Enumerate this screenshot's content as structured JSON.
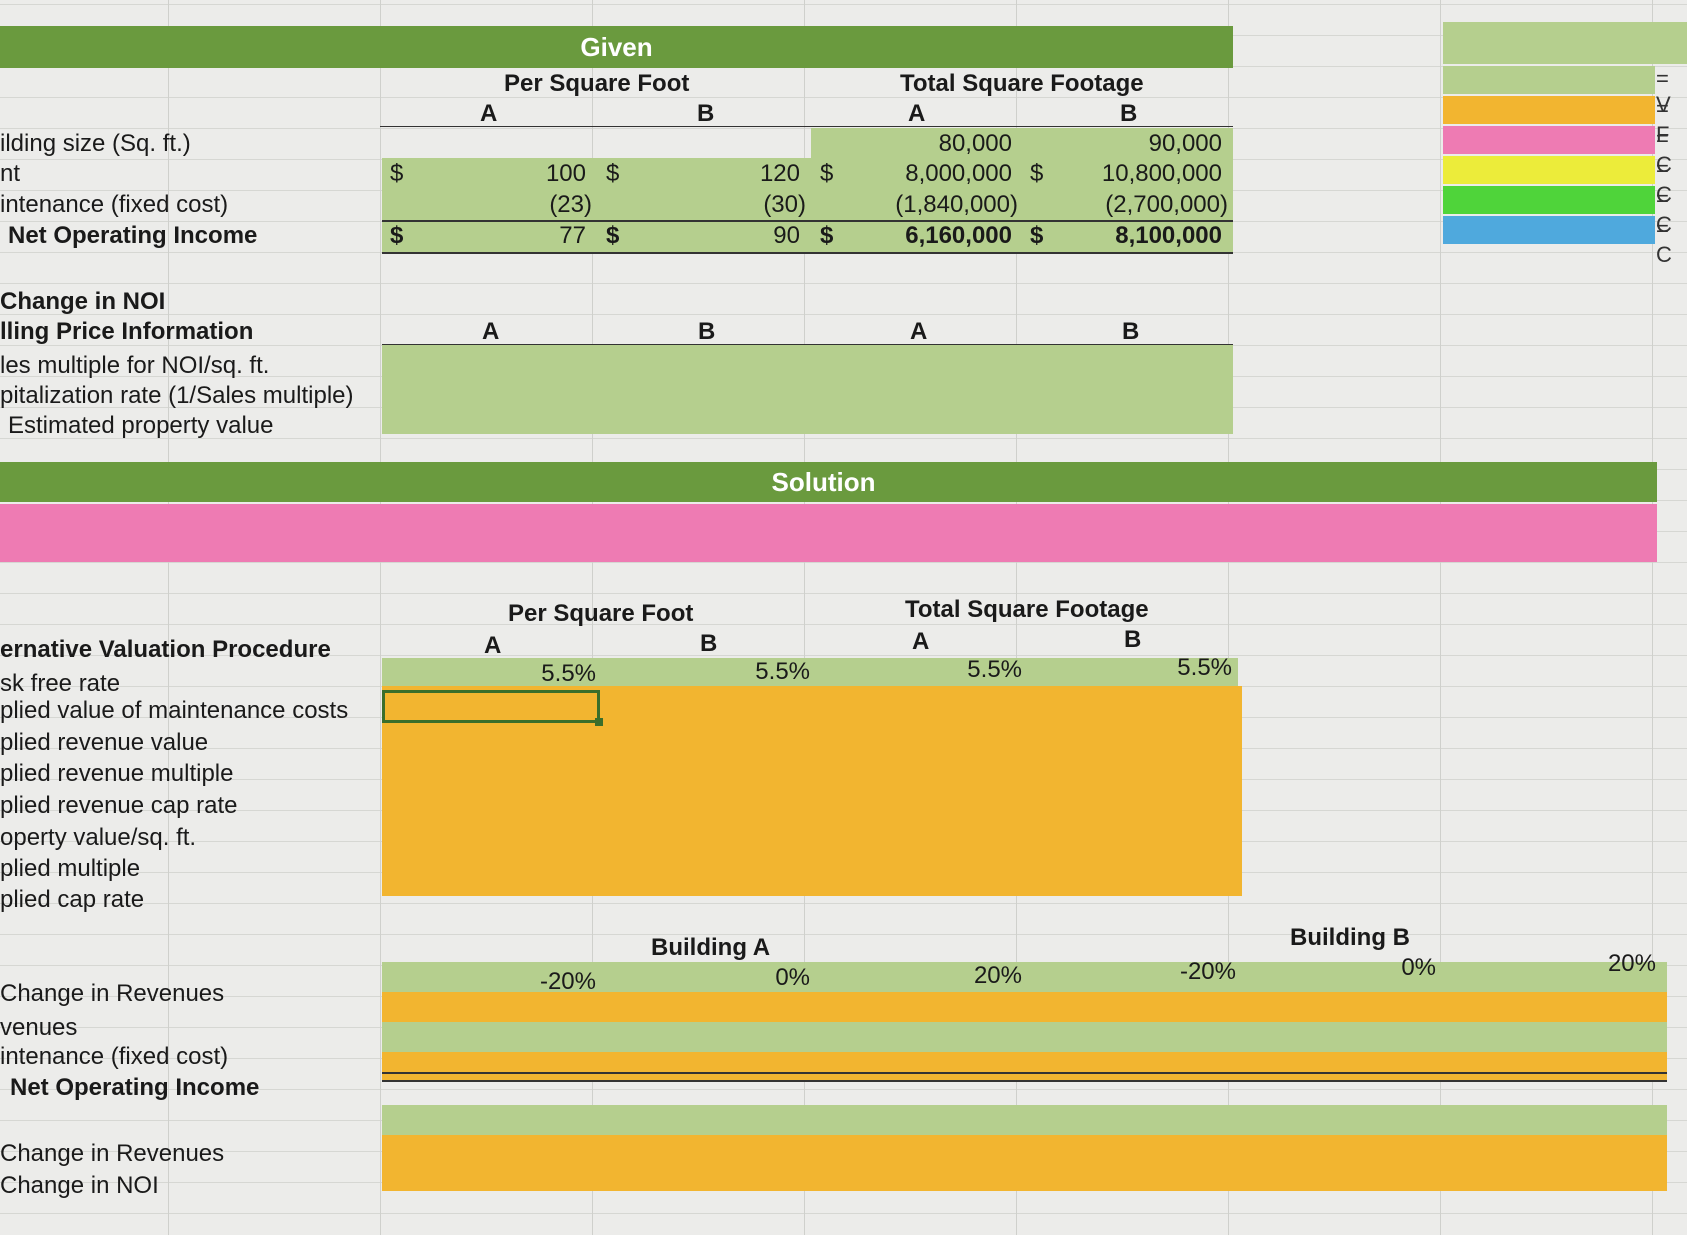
{
  "given": {
    "title": "Given",
    "per_sq_ft": "Per Square Foot",
    "total_sq_ft": "Total Square Footage",
    "col_a": "A",
    "col_b": "B",
    "rows": {
      "building_size": "ilding size (Sq. ft.)",
      "rent": "nt",
      "maintenance": "intenance (fixed cost)",
      "noi": "Net Operating Income"
    },
    "values": {
      "size_a_total": "80,000",
      "size_b_total": "90,000",
      "rent_a_psf": "100",
      "rent_b_psf": "120",
      "rent_a_total": "8,000,000",
      "rent_b_total": "10,800,000",
      "maint_a_psf": "(23)",
      "maint_b_psf": "(30)",
      "maint_a_total": "(1,840,000)",
      "maint_b_total": "(2,700,000)",
      "noi_a_psf": "77",
      "noi_b_psf": "90",
      "noi_a_total": "6,160,000",
      "noi_b_total": "8,100,000",
      "dollar": "$"
    },
    "change_noi": "Change in NOI",
    "selling_price_info": "lling Price Information",
    "sales_multiple": "les multiple for NOI/sq. ft.",
    "cap_rate": "pitalization rate (1/Sales multiple)",
    "est_value": "Estimated property value"
  },
  "solution": {
    "title": "Solution",
    "per_sq_ft": "Per Square Foot",
    "total_sq_ft": "Total Square Footage",
    "col_a": "A",
    "col_b": "B",
    "alt_valuation": "ernative Valuation Procedure",
    "risk_free": "sk free rate",
    "risk_free_values": [
      "5.5%",
      "5.5%",
      "5.5%",
      "5.5%"
    ],
    "rows": [
      "plied value of maintenance costs",
      "plied revenue value",
      "plied revenue multiple",
      "plied revenue cap rate",
      "operty value/sq. ft.",
      "plied multiple",
      "plied cap rate"
    ],
    "building_a": "Building A",
    "building_b": "Building B",
    "pct_values": [
      "-20%",
      "0%",
      "20%",
      "-20%",
      "0%",
      "20%"
    ],
    "lower_rows": [
      "Change in Revenues",
      "venues",
      "intenance (fixed cost)",
      "Net Operating Income"
    ],
    "bottom_rows": [
      "Change in Revenues",
      "Change in NOI"
    ]
  },
  "legend": {
    "colors": [
      "#b5cf8e",
      "#f2b530",
      "#ee7bb3",
      "#ecec3a",
      "#4fd43a",
      "#4fa9dd"
    ],
    "eq_labels": [
      "= V",
      "= F",
      "= C",
      "= C",
      "= C",
      "= C"
    ]
  }
}
